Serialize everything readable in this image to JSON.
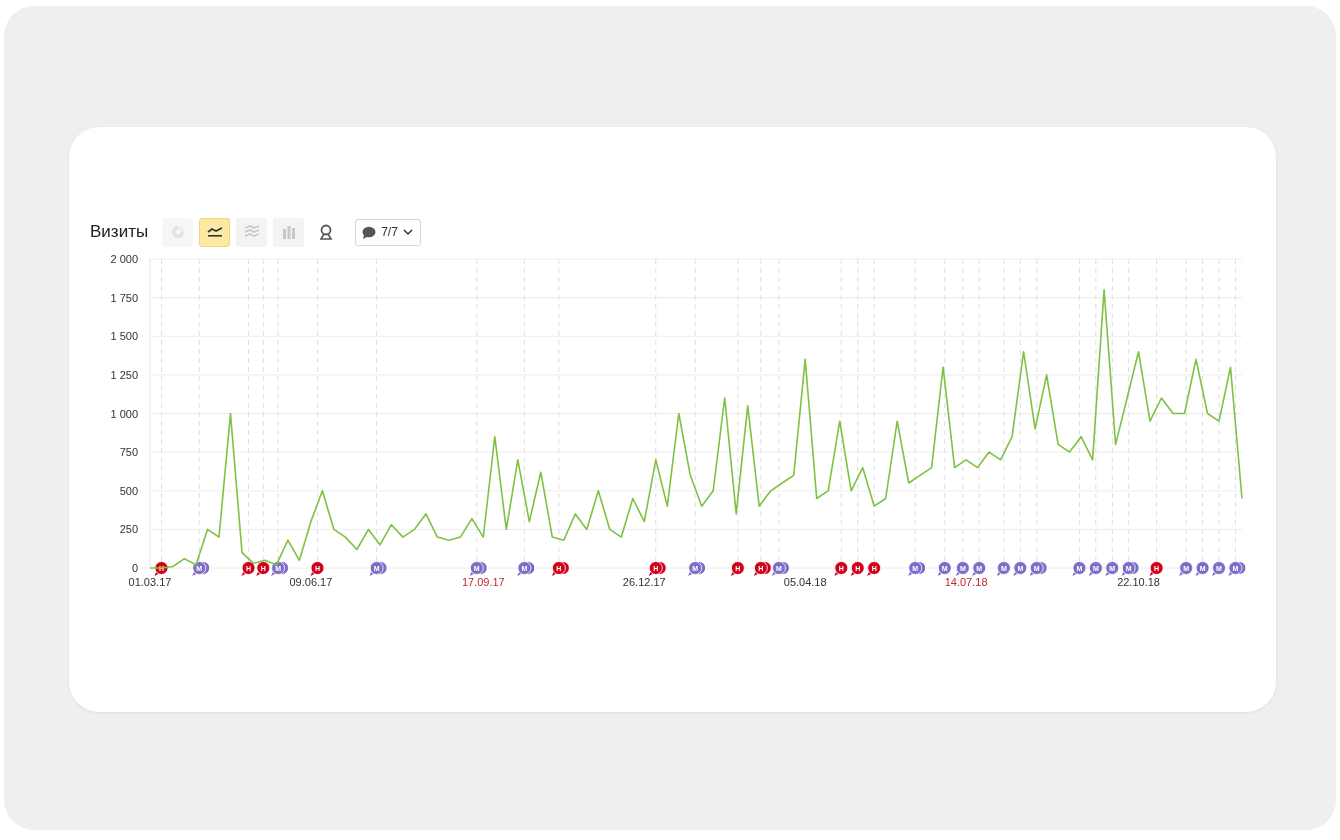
{
  "report": {
    "title": "Визиты",
    "view_buttons": [
      {
        "kind": "pie",
        "selected": false,
        "disabled": true
      },
      {
        "kind": "line",
        "selected": true,
        "disabled": false
      },
      {
        "kind": "area",
        "selected": false,
        "disabled": false
      },
      {
        "kind": "bars",
        "selected": false,
        "disabled": false
      },
      {
        "kind": "map",
        "selected": false,
        "disabled": false
      }
    ],
    "notes_filter": {
      "label": "7/7"
    },
    "chart_data": {
      "type": "line",
      "grid": true,
      "ylim": [
        0,
        2000
      ],
      "yticks": [
        {
          "value": 0,
          "label": "0"
        },
        {
          "value": 250,
          "label": "250"
        },
        {
          "value": 500,
          "label": "500"
        },
        {
          "value": 750,
          "label": "750"
        },
        {
          "value": 1000,
          "label": "1 000"
        },
        {
          "value": 1250,
          "label": "1 250"
        },
        {
          "value": 1500,
          "label": "1 500"
        },
        {
          "value": 1750,
          "label": "1 750"
        },
        {
          "value": 2000,
          "label": "2 000"
        }
      ],
      "categories": [
        "01.03.17",
        null,
        null,
        null,
        null,
        null,
        null,
        null,
        null,
        null,
        null,
        null,
        null,
        null,
        "09.06.17",
        null,
        null,
        null,
        null,
        null,
        null,
        null,
        null,
        null,
        null,
        null,
        null,
        null,
        null,
        "17.09.17",
        null,
        null,
        null,
        null,
        null,
        null,
        null,
        null,
        null,
        null,
        null,
        null,
        null,
        "26.12.17",
        null,
        null,
        null,
        null,
        null,
        null,
        null,
        null,
        null,
        null,
        null,
        null,
        null,
        "05.04.18",
        null,
        null,
        null,
        null,
        null,
        null,
        null,
        null,
        null,
        null,
        null,
        null,
        null,
        "14.07.18",
        null,
        null,
        null,
        null,
        null,
        null,
        null,
        null,
        null,
        null,
        null,
        null,
        null,
        null,
        "22.10.18",
        null,
        null,
        null,
        null,
        null,
        null,
        null,
        null,
        null
      ],
      "series": [
        {
          "color": "#7dc243",
          "values": [
            0,
            0,
            10,
            60,
            20,
            250,
            200,
            1000,
            100,
            30,
            50,
            20,
            180,
            50,
            300,
            500,
            250,
            200,
            120,
            250,
            150,
            280,
            200,
            250,
            350,
            200,
            180,
            200,
            320,
            200,
            850,
            250,
            700,
            300,
            620,
            200,
            180,
            350,
            250,
            500,
            250,
            200,
            450,
            300,
            700,
            400,
            1000,
            600,
            400,
            500,
            1100,
            350,
            1050,
            400,
            500,
            550,
            600,
            1350,
            450,
            500,
            950,
            500,
            650,
            400,
            450,
            950,
            550,
            600,
            650,
            1300,
            650,
            700,
            650,
            750,
            700,
            850,
            1400,
            900,
            1250,
            800,
            750,
            850,
            700,
            1800,
            800,
            1100,
            1400,
            950,
            1100,
            1000,
            1000,
            1350,
            1000,
            950,
            1300,
            450
          ]
        }
      ]
    },
    "date_label_weekend": [
      false,
      false,
      true,
      false,
      false,
      true,
      false
    ],
    "markers": [
      {
        "kind": "holiday",
        "label": "Н",
        "stacked": false
      },
      {
        "kind": "note",
        "label": "М",
        "stacked": true
      },
      {
        "kind": "holiday",
        "label": "Н",
        "stacked": false
      },
      {
        "kind": "holiday",
        "label": "Н",
        "stacked": false
      },
      {
        "kind": "note",
        "label": "М",
        "stacked": true
      },
      {
        "kind": "holiday",
        "label": "Н",
        "stacked": false
      },
      {
        "kind": "note",
        "label": "М",
        "stacked": true
      },
      {
        "kind": "note",
        "label": "М",
        "stacked": true
      },
      {
        "kind": "note",
        "label": "М",
        "stacked": true
      },
      {
        "kind": "holiday",
        "label": "Н",
        "stacked": true
      },
      {
        "kind": "holiday",
        "label": "Н",
        "stacked": true
      },
      {
        "kind": "note",
        "label": "М",
        "stacked": true
      },
      {
        "kind": "holiday",
        "label": "Н",
        "stacked": false
      },
      {
        "kind": "holiday",
        "label": "Н",
        "stacked": true
      },
      {
        "kind": "note",
        "label": "М",
        "stacked": true
      },
      {
        "kind": "holiday",
        "label": "Н",
        "stacked": false
      },
      {
        "kind": "holiday",
        "label": "Н",
        "stacked": false
      },
      {
        "kind": "holiday",
        "label": "Н",
        "stacked": false
      },
      {
        "kind": "note",
        "label": "М",
        "stacked": true
      },
      {
        "kind": "note",
        "label": "М",
        "stacked": false
      },
      {
        "kind": "note",
        "label": "М",
        "stacked": false
      },
      {
        "kind": "note",
        "label": "М",
        "stacked": false
      },
      {
        "kind": "note",
        "label": "М",
        "stacked": false
      },
      {
        "kind": "note",
        "label": "М",
        "stacked": false
      },
      {
        "kind": "note",
        "label": "М",
        "stacked": true
      },
      {
        "kind": "note",
        "label": "М",
        "stacked": false
      },
      {
        "kind": "note",
        "label": "М",
        "stacked": false
      },
      {
        "kind": "note",
        "label": "М",
        "stacked": false
      },
      {
        "kind": "note",
        "label": "М",
        "stacked": true
      },
      {
        "kind": "holiday",
        "label": "Н",
        "stacked": false
      },
      {
        "kind": "note",
        "label": "М",
        "stacked": false
      },
      {
        "kind": "note",
        "label": "М",
        "stacked": false
      },
      {
        "kind": "note",
        "label": "М",
        "stacked": false
      },
      {
        "kind": "note",
        "label": "М",
        "stacked": true
      }
    ]
  }
}
